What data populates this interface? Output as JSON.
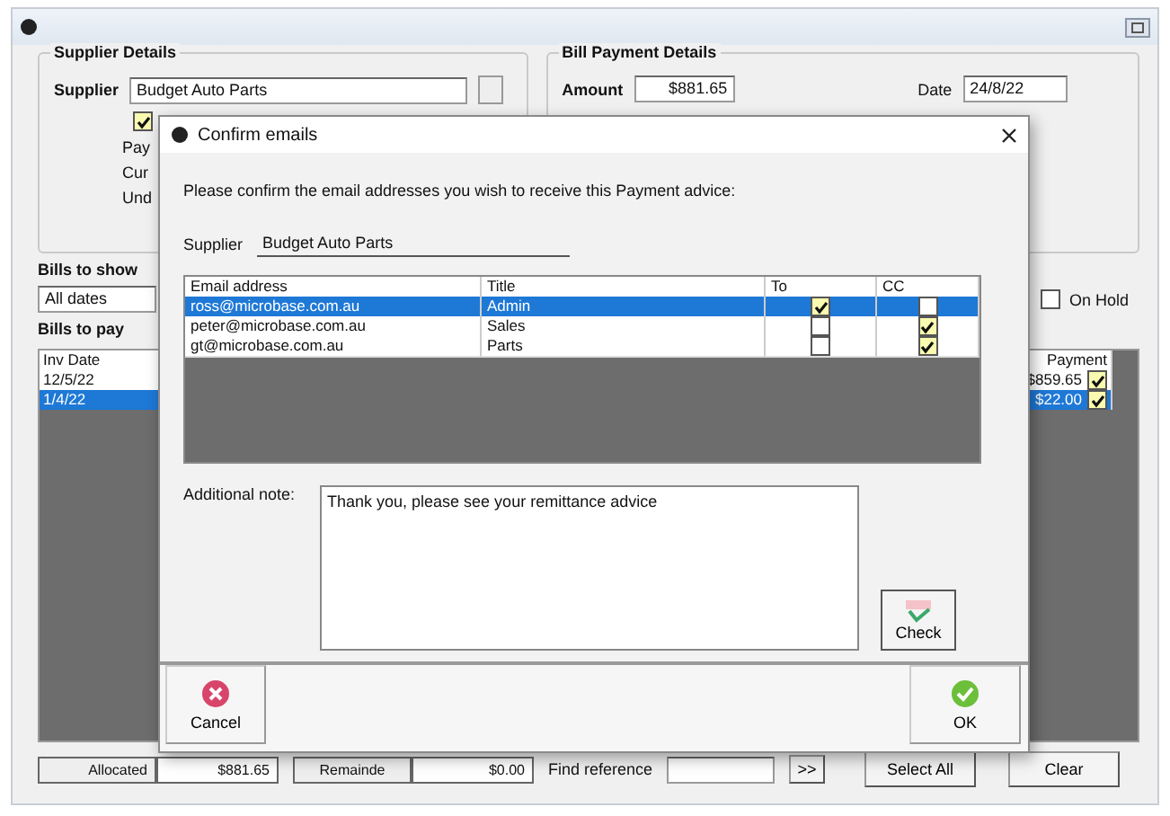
{
  "supplier_details": {
    "title": "Supplier Details",
    "supplier_label": "Supplier",
    "supplier": "Budget Auto Parts",
    "option": {
      "checked": true
    },
    "labels": [
      "Pay",
      "Cur",
      "Und"
    ]
  },
  "bill_payment_details": {
    "title": "Bill Payment Details",
    "amount_label": "Amount",
    "amount": "$881.65",
    "date_label": "Date",
    "date": "24/8/22"
  },
  "bills_to_show": {
    "title": "Bills to show",
    "filter": "All dates",
    "on_hold": {
      "label": "On Hold",
      "checked": false
    }
  },
  "bills_to_pay": {
    "title": "Bills to pay",
    "columns": [
      "Inv Date",
      "Payment"
    ],
    "rows": [
      {
        "inv_date": "12/5/22",
        "payment": "$859.65",
        "checked": true,
        "selected": false
      },
      {
        "inv_date": "1/4/22",
        "payment": "$22.00",
        "checked": true,
        "selected": true
      }
    ]
  },
  "footer": {
    "allocated_label": "Allocated",
    "allocated": "$881.65",
    "remainder_label": "Remainde",
    "remainder": "$0.00",
    "find_label": "Find reference",
    "find_button": ">>",
    "buttons": [
      "Select All",
      "Clear"
    ]
  },
  "dialog": {
    "title": "Confirm emails",
    "instruction": "Please confirm the email addresses you wish to receive this Payment advice:",
    "supplier_label": "Supplier",
    "supplier": "Budget Auto Parts",
    "columns": [
      "Email address",
      "Title",
      "To",
      "CC"
    ],
    "rows": [
      {
        "email": "ross@microbase.com.au",
        "title": "Admin",
        "to": true,
        "cc": false,
        "selected": true
      },
      {
        "email": "peter@microbase.com.au",
        "title": "Sales",
        "to": false,
        "cc": true,
        "selected": false
      },
      {
        "email": "gt@microbase.com.au",
        "title": "Parts",
        "to": false,
        "cc": true,
        "selected": false
      }
    ],
    "note_label": "Additional note:",
    "note": "Thank you, please see your remittance advice",
    "check_button": "Check",
    "cancel_button": "Cancel",
    "ok_button": "OK"
  }
}
